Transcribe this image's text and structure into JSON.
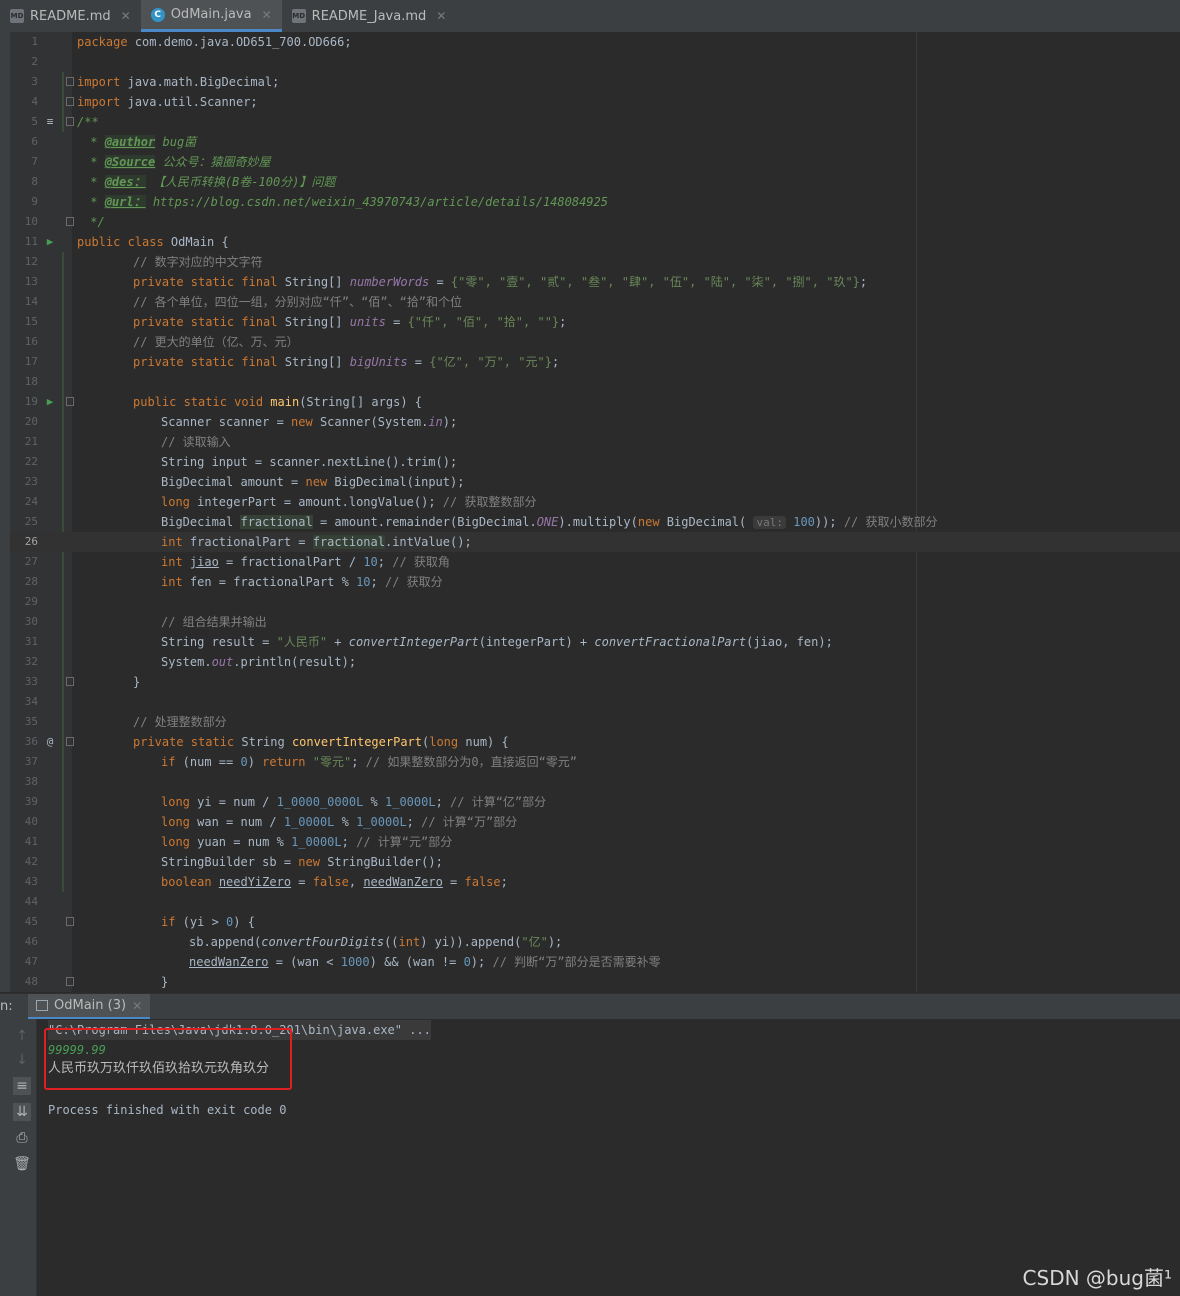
{
  "tabs": [
    {
      "label": "README.md",
      "icon": "markdown-file-icon",
      "active": false
    },
    {
      "label": "OdMain.java",
      "icon": "java-class-icon",
      "active": true
    },
    {
      "label": "README_Java.md",
      "icon": "markdown-file-icon",
      "active": false
    }
  ],
  "editor": {
    "line_numbers": [
      "1",
      "2",
      "3",
      "4",
      "5",
      "6",
      "7",
      "8",
      "9",
      "10",
      "11",
      "12",
      "13",
      "14",
      "15",
      "16",
      "17",
      "18",
      "19",
      "20",
      "21",
      "22",
      "23",
      "24",
      "25",
      "26",
      "27",
      "28",
      "29",
      "30",
      "31",
      "32",
      "33",
      "34",
      "35",
      "36",
      "37",
      "38",
      "39",
      "40",
      "41",
      "42",
      "43",
      "44",
      "45",
      "46",
      "47",
      "48"
    ],
    "caret_line": "26",
    "code": {
      "l1": "package com.demo.java.OD651_700.OD666;",
      "l3": "import java.math.BigDecimal;",
      "l4": "import java.util.Scanner;",
      "l5": "/**",
      "l6_tag": "@author",
      "l6_text": " bug菌",
      "l7_tag": "@Source",
      "l7_text": " 公众号：猿圈奇妙屋",
      "l8_tag": "@des：",
      "l8_text": " 【人民币转换(B卷-100分)】问题",
      "l9_tag": "@url：",
      "l9_text": " https://blog.csdn.net/weixin_43970743/article/details/148084925",
      "l10": " */",
      "l11": "public class OdMain {",
      "l12": "// 数字对应的中文字符",
      "l13_field": "numberWords",
      "l13_values": "{\"零\", \"壹\", \"贰\", \"叁\", \"肆\", \"伍\", \"陆\", \"柒\", \"捌\", \"玖\"}",
      "l14": "// 各个单位，四位一组，分别对应“仟”、“佰”、“拾”和个位",
      "l15_field": "units",
      "l15_values": "{\"仟\", \"佰\", \"拾\", \"\"}",
      "l16": "// 更大的单位（亿、万、元）",
      "l17_field": "bigUnits",
      "l17_values": "{\"亿\", \"万\", \"元\"}",
      "l19": "public static void main(String[] args) {",
      "l20": "Scanner scanner = new Scanner(System.in);",
      "l21": "// 读取输入",
      "l22": "String input = scanner.nextLine().trim();",
      "l23": "BigDecimal amount = new BigDecimal(input);",
      "l24": "long integerPart = amount.longValue(); // 获取整数部分",
      "l25_hint": "val:",
      "l25_comment": "// 获取小数部分",
      "l26": "int fractionalPart = fractional.intValue();",
      "l27": "int jiao = fractionalPart / 10; // 获取角",
      "l28": "int fen = fractionalPart % 10; // 获取分",
      "l30": "// 组合结果并输出",
      "l31": "String result = \"人民币\" + convertIntegerPart(integerPart) + convertFractionalPart(jiao, fen);",
      "l32": "System.out.println(result);",
      "l33": "}",
      "l35": "// 处理整数部分",
      "l36": "private static String convertIntegerPart(long num) {",
      "l37_comment": "// 如果整数部分为0，直接返回“零元”",
      "l39_comment": "// 计算“亿”部分",
      "l40_comment": "// 计算“万”部分",
      "l41_comment": "// 计算“元”部分",
      "l42": "StringBuilder sb = new StringBuilder();",
      "l43": "boolean needYiZero = false, needWanZero = false;",
      "l45": "if (yi > 0) {",
      "l46": "sb.append(convertFourDigits((int) yi)).append(\"亿\");",
      "l47_comment": "// 判断“万”部分是否需要补零",
      "l48": "}"
    }
  },
  "run_panel": {
    "label": "n:",
    "tab_label": "OdMain (3)",
    "command": "\"C:\\Program Files\\Java\\jdk1.8.0_201\\bin\\java.exe\" ...",
    "input": "99999.99",
    "output": "人民币玖万玖仟玖佰玖拾玖元玖角玖分",
    "exit": "Process finished with exit code 0"
  },
  "watermark": "CSDN @bug菌¹",
  "colors": {
    "keyword": "#cc7832",
    "string": "#6a8759",
    "number": "#6897bb",
    "comment": "#808080",
    "highlight_box": "#e02020"
  }
}
